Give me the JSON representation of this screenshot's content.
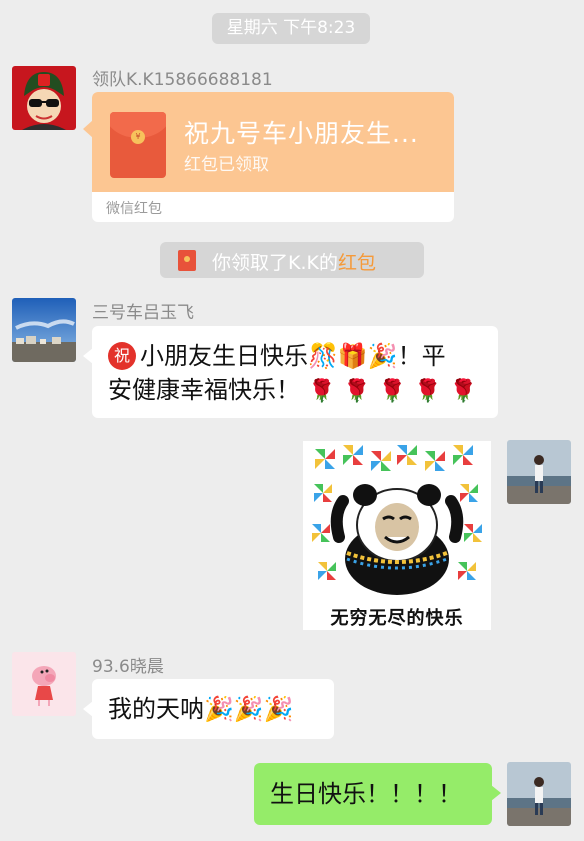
{
  "timestamp": "星期六 下午8:23",
  "messages": {
    "packet": {
      "sender": "领队K.K15866688181",
      "title": "祝九号车小朋友生...",
      "status": "红包已领取",
      "brand": "微信红包",
      "coin": "¥"
    },
    "notice": {
      "text_before": "你领取了K.K的",
      "highlight": "红包"
    },
    "bday": {
      "sender": "三号车吕玉飞",
      "bless_glyph": "祝",
      "line1": "小朋友生日快乐",
      "line1_end": "！平",
      "line2": "安健康幸福快乐！",
      "emojis": [
        "🎊",
        "🎁",
        "🎉"
      ],
      "tulips": [
        "🌹",
        "🌹",
        "🌹",
        "🌹",
        "🌹"
      ]
    },
    "sticker": {
      "caption": "无穷无尽的快乐"
    },
    "wow": {
      "sender": "93.6晓晨",
      "text": "我的天呐",
      "emojis": [
        "🎉",
        "🎉",
        "🎉"
      ]
    },
    "mine": {
      "text": "生日快乐！！！！"
    }
  },
  "colors": {
    "packet": "#fcc692",
    "my_bubble": "#95ec69",
    "highlight": "#f59a3a",
    "background": "#ededed"
  }
}
